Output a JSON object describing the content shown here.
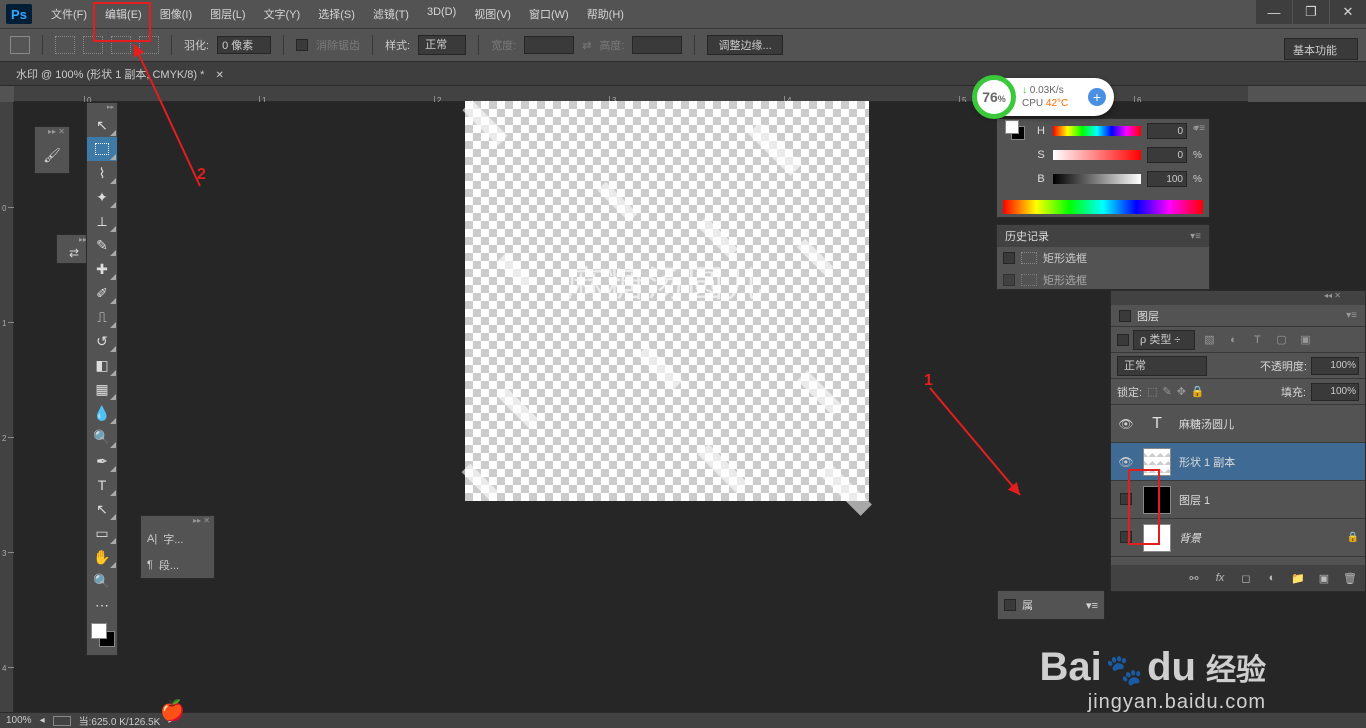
{
  "app_logo": "Ps",
  "menu": [
    "文件(F)",
    "编辑(E)",
    "图像(I)",
    "图层(L)",
    "文字(Y)",
    "选择(S)",
    "滤镜(T)",
    "3D(D)",
    "视图(V)",
    "窗口(W)",
    "帮助(H)"
  ],
  "win_controls": {
    "min": "—",
    "max": "❐",
    "close": "✕"
  },
  "options": {
    "feather_label": "羽化:",
    "feather_value": "0 像素",
    "antialias": "消除锯齿",
    "style_label": "样式:",
    "style_value": "正常",
    "width_label": "宽度:",
    "height_label": "高度:",
    "refine_edge": "调整边缘...",
    "workspace": "基本功能"
  },
  "tab_title": "水印 @ 100% (形状 1 副本, CMYK/8) *",
  "canvas_text": "麻糖汤圆儿",
  "hsb": {
    "h_label": "H",
    "s_label": "S",
    "b_label": "B",
    "h_val": "0",
    "s_val": "0",
    "b_val": "100",
    "deg": "°",
    "pct": "%"
  },
  "history": {
    "title": "历史记录",
    "items": [
      "矩形选框",
      "矩形选框"
    ]
  },
  "layers": {
    "title": "图层",
    "filter": "类型",
    "blend": "正常",
    "opacity_label": "不透明度:",
    "opacity": "100%",
    "lock_label": "锁定:",
    "fill_label": "填充:",
    "fill": "100%",
    "items": [
      {
        "name": "麻糖汤圆儿",
        "type": "text",
        "visible": true
      },
      {
        "name": "形状 1 副本",
        "type": "shape",
        "visible": true,
        "selected": true
      },
      {
        "name": "图层 1",
        "type": "raster",
        "visible": false
      },
      {
        "name": "背景",
        "type": "bg",
        "visible": false,
        "locked": true
      }
    ]
  },
  "prop_panel": "属",
  "char_panel": {
    "char": "字...",
    "para": "段..."
  },
  "status": {
    "zoom": "100%",
    "doc_size": "当:625.0 K/126.5K"
  },
  "perf": {
    "pct": "76",
    "pct_unit": "%",
    "speed": "0.03K/s",
    "cpu_label": "CPU",
    "cpu_temp": "42°C"
  },
  "annotations": {
    "num1": "1",
    "num2": "2"
  },
  "brand": {
    "logo": "Bai",
    "logo2": "du",
    "logo3": "经验",
    "sub": "jingyan.baidu.com"
  }
}
